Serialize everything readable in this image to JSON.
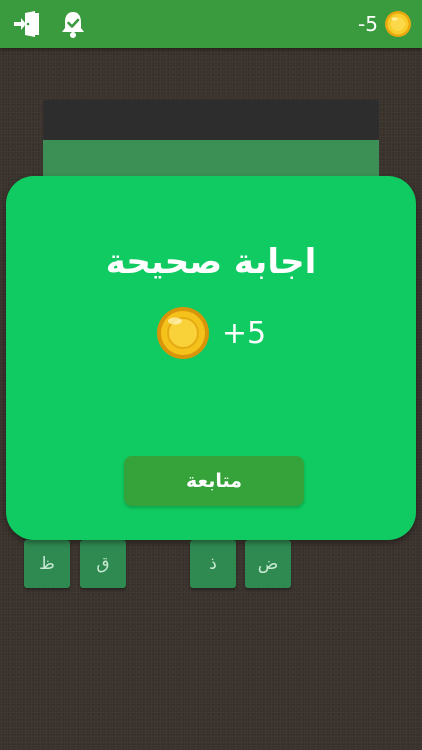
{
  "topbar": {
    "coins": "-5",
    "exit_icon": "exit-door-icon",
    "bell_icon": "bell-check-icon",
    "coin_icon": "coin-icon"
  },
  "letters": [
    "ظ",
    "ق",
    "ذ",
    "ض"
  ],
  "dialog": {
    "title": "اجابة صحيحة",
    "reward": "+5",
    "continue_label": "متابعة"
  },
  "colors": {
    "topbar": "#3a9a3e",
    "dialog": "#0fcb61",
    "button": "#35a33a",
    "coin": "#f5c518",
    "background": "#3a322c"
  }
}
